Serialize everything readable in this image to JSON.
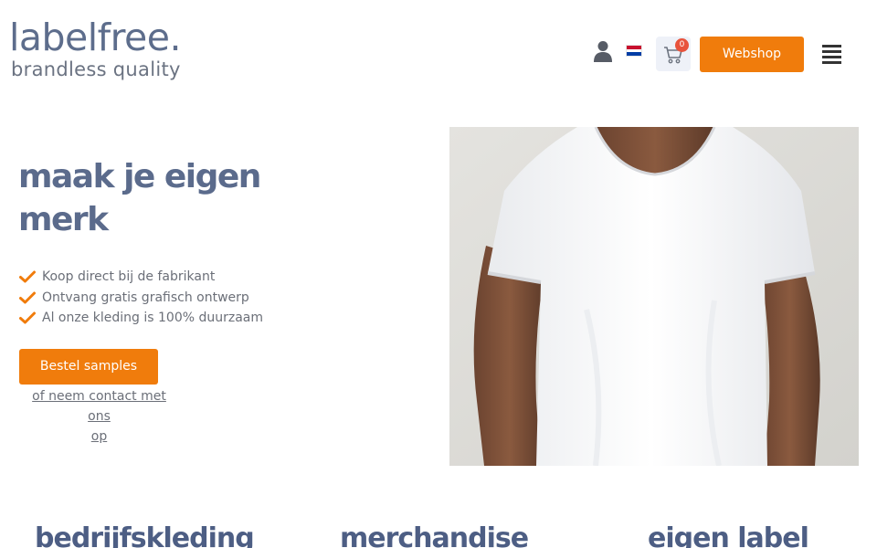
{
  "header": {
    "logo": {
      "main": "labelfree.",
      "tagline": "brandless quality"
    },
    "icons": {
      "account": "user-icon",
      "language": "netherlands-flag-icon",
      "cart": "cart-icon",
      "menu": "hamburger-menu-icon"
    },
    "cart_count": "0",
    "webshop_label": "Webshop"
  },
  "hero": {
    "title_line1": "maak je eigen",
    "title_line2": "merk",
    "usps": [
      "Koop direct bij de fabrikant",
      "Ontvang gratis grafisch ontwerp",
      "Al onze kleding is 100% duurzaam"
    ],
    "cta_label": "Bestel samples",
    "contact_line1": "of neem contact met ons",
    "contact_line2": "op"
  },
  "categories": [
    "bedrijfskleding",
    "merchandise",
    "eigen label"
  ],
  "colors": {
    "accent": "#f07c0c",
    "brand": "#5b6b8c",
    "badge": "#e8533c"
  }
}
